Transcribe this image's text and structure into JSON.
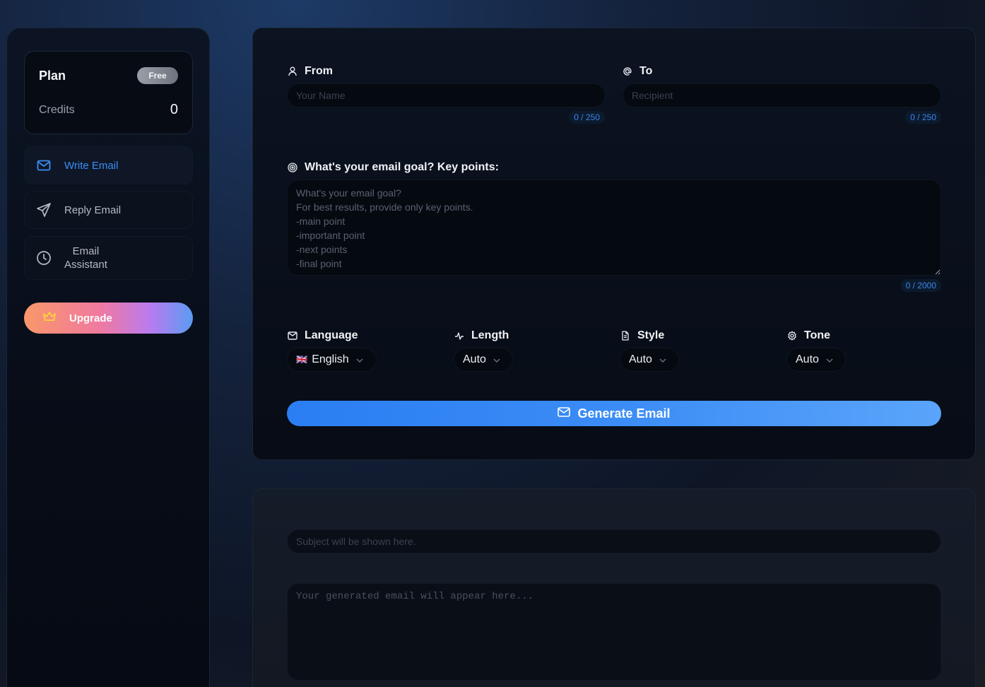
{
  "sidebar": {
    "plan": {
      "title": "Plan",
      "badge": "Free",
      "credits_label": "Credits",
      "credits_value": "0"
    },
    "items": [
      {
        "label": "Write Email",
        "icon": "mail-icon",
        "active": true
      },
      {
        "label": "Reply Email",
        "icon": "send-icon",
        "active": false
      },
      {
        "label": "Email\nAssistant",
        "icon": "clock-icon",
        "active": false
      }
    ],
    "upgrade": {
      "label": "Upgrade",
      "icon": "crown-icon"
    }
  },
  "form": {
    "from": {
      "label": "From",
      "icon": "user-icon",
      "placeholder": "Your Name",
      "value": "",
      "counter": "0 / 250"
    },
    "to": {
      "label": "To",
      "icon": "at-icon",
      "placeholder": "Recipient",
      "value": "",
      "counter": "0 / 250"
    },
    "goal": {
      "label": "What's your email goal? Key points:",
      "icon": "target-icon",
      "placeholder": "What's your email goal?\nFor best results, provide only key points.\n-main point\n-important point\n-next points\n-final point",
      "counter": "0 / 2000"
    },
    "options": {
      "language": {
        "label": "Language",
        "icon": "mail-icon",
        "value": "English",
        "flag": "🇬🇧"
      },
      "length": {
        "label": "Length",
        "icon": "pulse-icon",
        "value": "Auto"
      },
      "style": {
        "label": "Style",
        "icon": "document-icon",
        "value": "Auto"
      },
      "tone": {
        "label": "Tone",
        "icon": "gear-icon",
        "value": "Auto"
      }
    },
    "generate_label": "Generate Email"
  },
  "output": {
    "subject_placeholder": "Subject will be shown here.",
    "body_placeholder": "Your generated email will appear here..."
  },
  "colors": {
    "accent": "#3b8df4",
    "counter_text": "#3a86e8",
    "upgrade_gradient": [
      "#f9976a",
      "#f07aa0",
      "#b97bf0",
      "#5a9bf2"
    ]
  }
}
